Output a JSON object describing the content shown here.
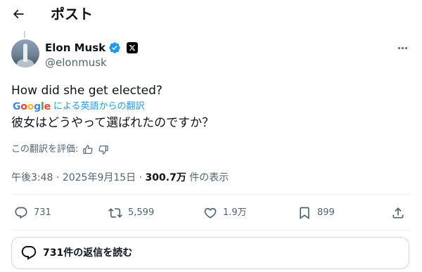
{
  "header": {
    "title": "ポスト",
    "back_icon": "arrow-left-icon"
  },
  "author": {
    "display_name": "Elon Musk",
    "handle": "@elonmusk",
    "verified_color": "#1d9bf0"
  },
  "post": {
    "text": "How did she get elected?",
    "translate_brand": "Google",
    "translate_label": "による英語からの翻訳",
    "translated_text": "彼女はどうやって選ばれたのですか？",
    "rate_label": "この翻訳を評価:"
  },
  "meta": {
    "time": "午後3:48",
    "separator": "·",
    "date": "2025年9月15日",
    "views_count": "300.7万",
    "views_label": "件の表示"
  },
  "actions": {
    "replies": "731",
    "reposts": "5,599",
    "likes": "1.9万",
    "bookmarks": "899"
  },
  "replies_button": {
    "label": "731件の返信を読む"
  },
  "colors": {
    "accent": "#1d9bf0",
    "muted": "#536471",
    "text": "#0f1419",
    "border": "#cfd9de"
  }
}
